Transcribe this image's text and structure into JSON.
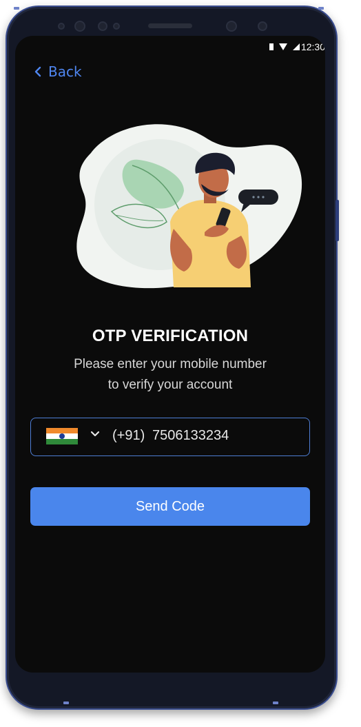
{
  "status_bar": {
    "time": "12:30"
  },
  "nav": {
    "back_label": "Back"
  },
  "content": {
    "title": "OTP VERIFICATION",
    "subtitle_line1": "Please enter your mobile number",
    "subtitle_line2": "to verify your account"
  },
  "phone_input": {
    "country_code": "(+91)",
    "number": "7506133234",
    "country_flag": "india-flag-icon"
  },
  "actions": {
    "send_label": "Send Code"
  },
  "colors": {
    "accent": "#4a86ec",
    "background": "#0b0b0b",
    "input_border": "#4f7fd6"
  }
}
